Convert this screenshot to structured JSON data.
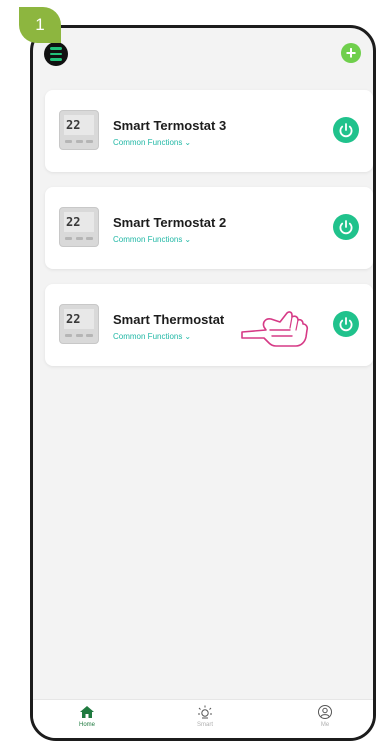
{
  "step_badge": "1",
  "top_bar": {
    "menu_icon": "menu-icon",
    "add_icon": "add-icon"
  },
  "devices": [
    {
      "name": "Smart Termostat 3",
      "subtitle": "Common Functions",
      "display_value": "22",
      "icon": "thermostat-icon"
    },
    {
      "name": "Smart Termostat 2",
      "subtitle": "Common Functions",
      "display_value": "22",
      "icon": "thermostat-icon"
    },
    {
      "name": "Smart Thermostat",
      "subtitle": "Common Functions",
      "display_value": "22",
      "icon": "thermostat-icon"
    }
  ],
  "tabs": [
    {
      "label": "Home",
      "icon": "home-icon",
      "active": true
    },
    {
      "label": "Smart",
      "icon": "sun-icon",
      "active": false
    },
    {
      "label": "Me",
      "icon": "profile-icon",
      "active": false
    }
  ],
  "colors": {
    "badge": "#8db63f",
    "power": "#20c28c",
    "accent_text": "#22b8a6",
    "hand": "#d63a86",
    "home_active": "#1f7a3f"
  }
}
